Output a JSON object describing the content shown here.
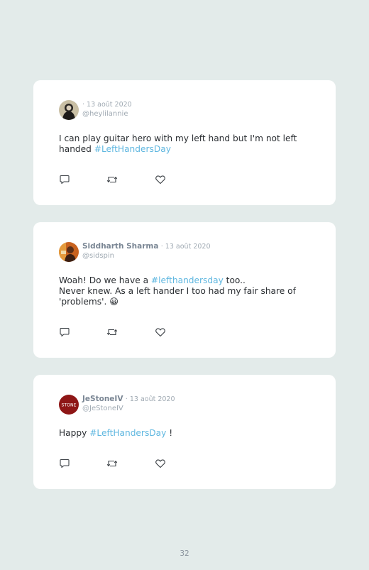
{
  "tweets": [
    {
      "name": "",
      "date": "· 13 août 2020",
      "handle": "@heylilannie",
      "text_parts": [
        "I can play guitar hero with my left hand but I'm not left handed ",
        "#LeftHandersDay"
      ],
      "icons": [
        "reply-icon",
        "retweet-icon",
        "like-icon"
      ]
    },
    {
      "name": "Siddharth Sharma",
      "date": "· 13 août 2020",
      "handle": "@sidspin",
      "text_parts": [
        "Woah! Do we have a ",
        "#lefthandersday",
        " too..",
        "Never knew. As a left hander I too had my fair share of 'problems'. ",
        "😀"
      ],
      "icons": [
        "reply-icon",
        "retweet-icon",
        "like-icon"
      ]
    },
    {
      "name": "JeStoneIV",
      "date": "· 13 août 2020",
      "handle": "@JeStoneIV",
      "avatar_text": "STONE",
      "text_parts": [
        "Happy ",
        "#LeftHandersDay",
        " !"
      ],
      "icons": [
        "reply-icon",
        "retweet-icon",
        "like-icon"
      ]
    }
  ],
  "page_number": "32",
  "colors": {
    "background": "#e3ebea",
    "card": "#ffffff",
    "hashtag": "#5fb7e0",
    "meta": "#a0aab3"
  }
}
